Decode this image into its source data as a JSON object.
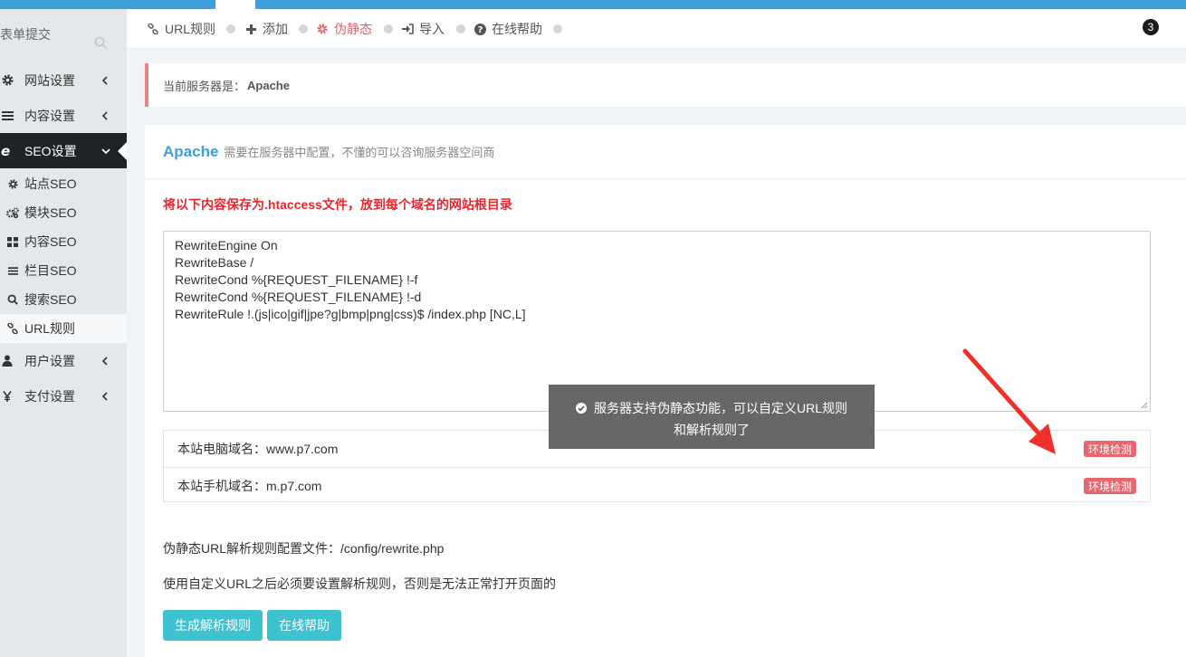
{
  "sidebar": {
    "search_placeholder": "表单提交",
    "items": [
      {
        "label": "网站设置"
      },
      {
        "label": "内容设置"
      },
      {
        "label": "SEO设置"
      }
    ],
    "sub_items": [
      {
        "label": "站点SEO"
      },
      {
        "label": "模块SEO"
      },
      {
        "label": "内容SEO"
      },
      {
        "label": "栏目SEO"
      },
      {
        "label": "搜索SEO"
      },
      {
        "label": "URL规则"
      }
    ],
    "items_after": [
      {
        "label": "用户设置"
      },
      {
        "label": "支付设置"
      }
    ]
  },
  "tabs": [
    {
      "label": "URL规则"
    },
    {
      "label": "添加"
    },
    {
      "label": "伪静态"
    },
    {
      "label": "导入"
    },
    {
      "label": "在线帮助"
    }
  ],
  "notification_count": "3",
  "alert": {
    "prefix": "当前服务器是：",
    "server": "Apache"
  },
  "panel": {
    "title": "Apache",
    "subtitle": "需要在服务器中配置，不懂的可以咨询服务器空间商",
    "warning": "将以下内容保存为.htaccess文件，放到每个域名的网站根目录",
    "code": "RewriteEngine On\nRewriteBase /\nRewriteCond %{REQUEST_FILENAME} !-f\nRewriteCond %{REQUEST_FILENAME} !-d\nRewriteRule !.(js|ico|gif|jpe?g|bmp|png|css)$ /index.php [NC,L]",
    "domains": [
      {
        "label": "本站电脑域名：www.p7.com",
        "button": "环境检测"
      },
      {
        "label": "本站手机域名：m.p7.com",
        "button": "环境检测"
      }
    ],
    "config_line": "伪静态URL解析规则配置文件：/config/rewrite.php",
    "note_line": "使用自定义URL之后必须要设置解析规则，否则是无法正常打开页面的",
    "buttons": {
      "generate": "生成解析规则",
      "help": "在线帮助"
    }
  },
  "toast": {
    "line1": "服务器支持伪静态功能，可以自定义URL规则",
    "line2": "和解析规则了"
  },
  "colors": {
    "accent": "#3d9fd9",
    "danger": "#e8666d",
    "teal": "#3fc2cf",
    "active_tab": "#e0626b"
  }
}
